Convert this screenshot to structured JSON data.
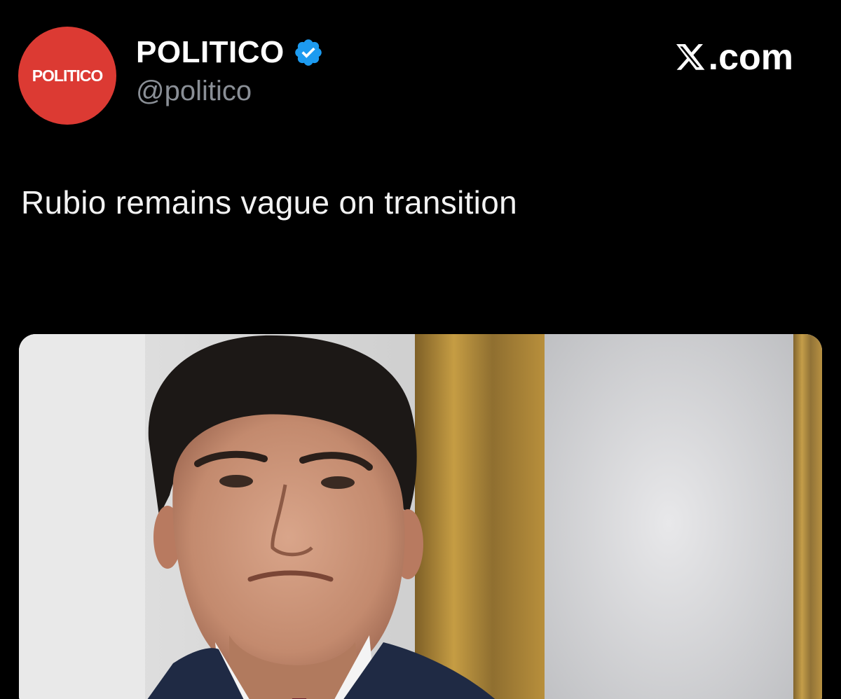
{
  "account": {
    "avatar_wordmark": "POLITICO",
    "display_name": "POLITICO",
    "handle": "@politico",
    "verified": true,
    "avatar_color": "#dc3a33",
    "verified_color": "#1d9bf0"
  },
  "brand": {
    "label": ".com",
    "icon": "x-logo-icon"
  },
  "post": {
    "text": "Rubio remains vague on transition"
  },
  "media": {
    "description_icon": "photo-icon"
  },
  "colors": {
    "background": "#000000",
    "handle_gray": "#8a8f96"
  }
}
